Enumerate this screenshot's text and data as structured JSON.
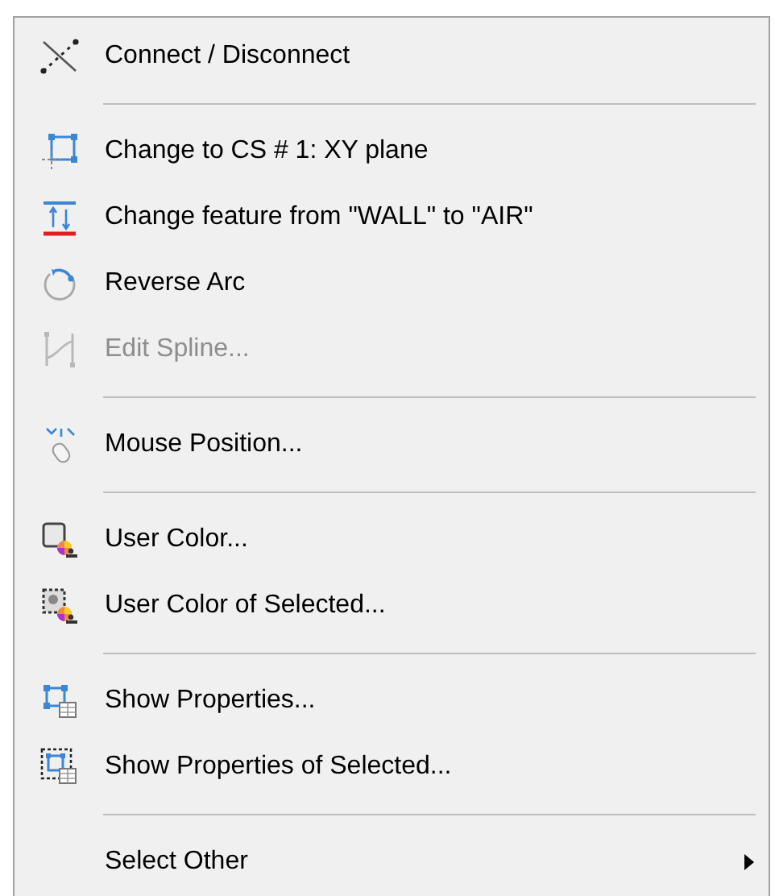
{
  "menu": {
    "items": [
      {
        "kind": "item",
        "label": "Connect / Disconnect",
        "disabled": false,
        "submenu": false
      },
      {
        "kind": "separator"
      },
      {
        "kind": "item",
        "label": "Change to CS # 1: XY plane",
        "disabled": false,
        "submenu": false
      },
      {
        "kind": "item",
        "label": "Change feature from \"WALL\" to \"AIR\"",
        "disabled": false,
        "submenu": false
      },
      {
        "kind": "item",
        "label": "Reverse Arc",
        "disabled": false,
        "submenu": false
      },
      {
        "kind": "item",
        "label": "Edit Spline...",
        "disabled": true,
        "submenu": false
      },
      {
        "kind": "separator"
      },
      {
        "kind": "item",
        "label": "Mouse Position...",
        "disabled": false,
        "submenu": false
      },
      {
        "kind": "separator"
      },
      {
        "kind": "item",
        "label": "User Color...",
        "disabled": false,
        "submenu": false
      },
      {
        "kind": "item",
        "label": "User Color of Selected...",
        "disabled": false,
        "submenu": false
      },
      {
        "kind": "separator"
      },
      {
        "kind": "item",
        "label": "Show Properties...",
        "disabled": false,
        "submenu": false
      },
      {
        "kind": "item",
        "label": "Show Properties of Selected...",
        "disabled": false,
        "submenu": false
      },
      {
        "kind": "separator"
      },
      {
        "kind": "item",
        "label": "Select Other",
        "disabled": false,
        "submenu": true
      }
    ]
  }
}
